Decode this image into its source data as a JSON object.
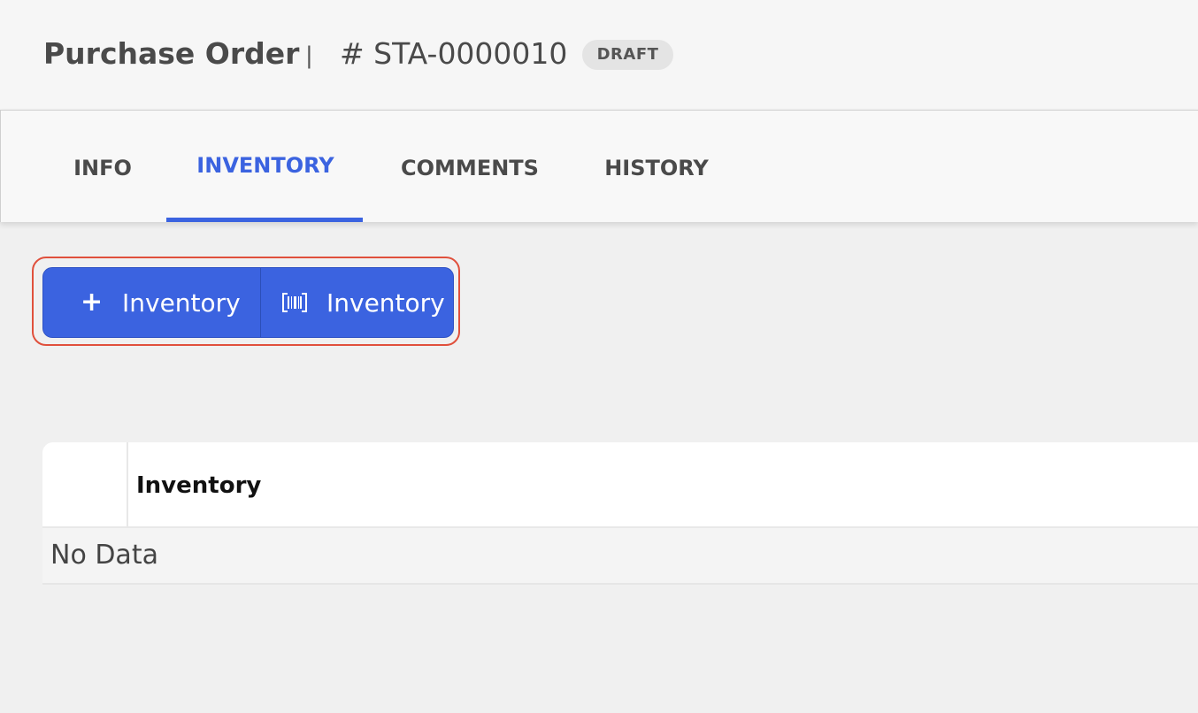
{
  "header": {
    "title": "Purchase Order",
    "separator": "|",
    "order_number": "# STA-0000010",
    "status": "DRAFT"
  },
  "tabs": [
    {
      "label": "INFO",
      "active": false
    },
    {
      "label": "INVENTORY",
      "active": true
    },
    {
      "label": "COMMENTS",
      "active": false
    },
    {
      "label": "HISTORY",
      "active": false
    }
  ],
  "actions": {
    "add_inventory": {
      "icon": "plus-icon",
      "glyph": "+",
      "label": "Inventory"
    },
    "scan_inventory": {
      "icon": "barcode-icon",
      "label": "Inventory"
    }
  },
  "table": {
    "columns": [
      "Inventory"
    ],
    "empty_text": "No Data"
  },
  "colors": {
    "accent": "#3b63e0",
    "highlight": "#e0503c",
    "badge_bg": "#e4e4e4"
  }
}
